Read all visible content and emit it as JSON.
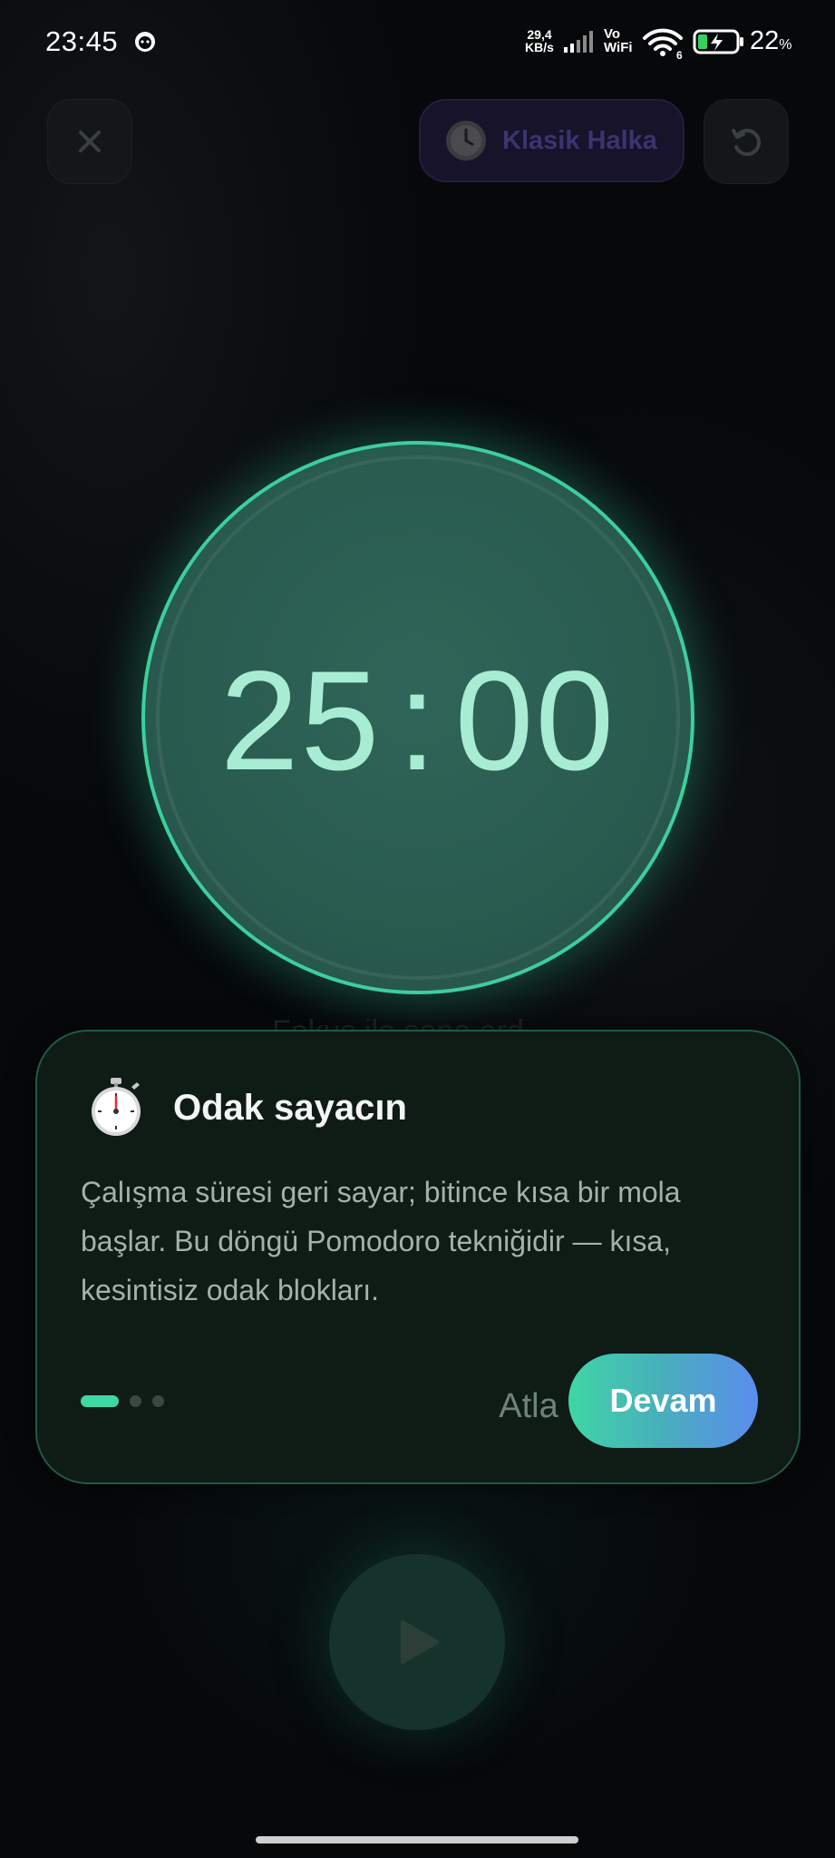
{
  "status_bar": {
    "time": "23:45",
    "speed": "29,4\nKB/s",
    "vowifi": "Vo\nWiFi",
    "wifi_badge": "6",
    "battery_level": "22",
    "battery_unit": "%"
  },
  "header": {
    "style_label": "Klasik Halka"
  },
  "timer": {
    "display": "25:00",
    "behind_label": "Fokus ile sona erd"
  },
  "tip_card": {
    "title": "Odak sayacın",
    "body": "Çalışma süresi geri sayar; bitince kısa bir mola başlar. Bu döngü Pomodoro tekniğidir — kısa, kesintisiz odak blokları.",
    "skip_label": "Atla",
    "continue_label": "Devam",
    "pages": 3,
    "current_page": 1
  },
  "colors": {
    "accent": "#3ccf9d",
    "timer_text": "#a8ecd4",
    "card_bg": "#0f1b15",
    "card_border": "#1f5a45",
    "button_gradient_start": "#3ed6a6",
    "button_gradient_end": "#5b8def"
  },
  "icons": {
    "close": "close-icon",
    "style": "clock-icon",
    "reset": "reset-icon",
    "tip": "stopwatch-icon",
    "play": "play-icon"
  }
}
